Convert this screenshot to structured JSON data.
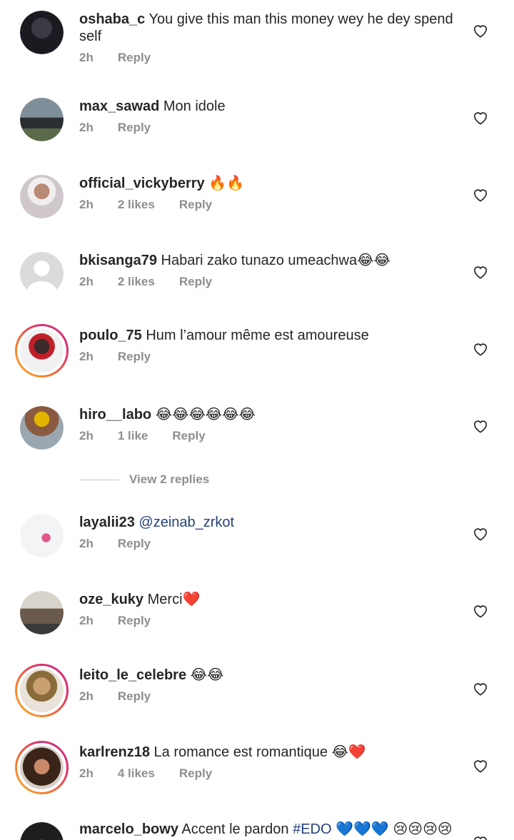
{
  "comments": [
    {
      "username": "oshaba_c",
      "text": "You give this man this money wey he dey spend",
      "text2": "self",
      "time": "2h",
      "likes": "",
      "reply": "Reply",
      "avatar_color": "#1d1d24"
    },
    {
      "username": "max_sawad",
      "text": "Mon idole",
      "time": "2h",
      "likes": "",
      "reply": "Reply",
      "avatar_color": "#4a5560"
    },
    {
      "username": "official_vickyberry",
      "text": "🔥🔥",
      "time": "2h",
      "likes": "2 likes",
      "reply": "Reply",
      "avatar_color": "#a77a6a"
    },
    {
      "username": "bkisanga79",
      "text": "Habari zako tunazo umeachwa😂😂",
      "time": "2h",
      "likes": "2 likes",
      "reply": "Reply",
      "avatar_color": "#dcdcdc"
    },
    {
      "username": "poulo_75",
      "text": "Hum l’amour même est amoureuse",
      "time": "2h",
      "likes": "",
      "reply": "Reply",
      "avatar_color": "#3a3a3a"
    },
    {
      "username": "hiro__labo",
      "text": "😂😂😂😂😂😂",
      "time": "2h",
      "likes": "1 like",
      "reply": "Reply",
      "avatar_color": "#7a7f86"
    },
    {
      "username": "layalii23",
      "mention": "@zeinab_zrkot",
      "time": "2h",
      "likes": "",
      "reply": "Reply",
      "avatar_color": "#e8eef2"
    },
    {
      "username": "oze_kuky",
      "text": "Merci❤️",
      "time": "2h",
      "likes": "",
      "reply": "Reply",
      "avatar_color": "#6a5a4e"
    },
    {
      "username": "leito_le_celebre",
      "text": "😂😂",
      "time": "2h",
      "likes": "",
      "reply": "Reply",
      "avatar_color": "#8a6c3a"
    },
    {
      "username": "karlrenz18",
      "text": "La romance est romantique 😂❤️",
      "time": "2h",
      "likes": "4 likes",
      "reply": "Reply",
      "avatar_color": "#5a3a2a"
    },
    {
      "username": "marcelo_bowy",
      "text": "Accent le pardon",
      "hashtag": "#EDO",
      "text_tail": "💙💙💙 😢😢😢😢",
      "avatar_color": "#2a2a2a"
    }
  ],
  "view_replies": "View 2 replies"
}
